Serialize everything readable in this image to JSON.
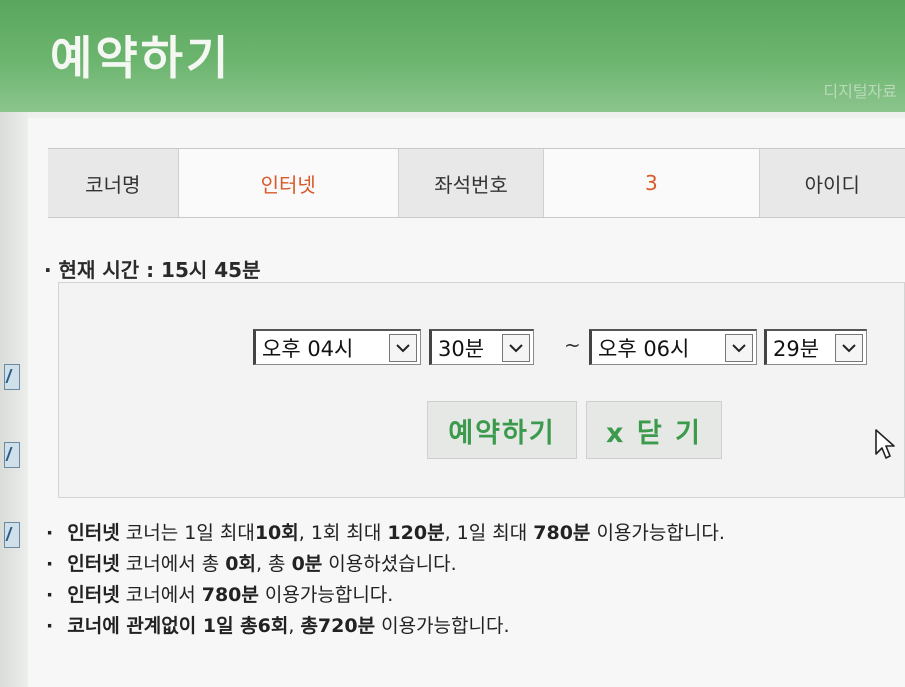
{
  "header": {
    "title": "예약하기",
    "corner_text": "디지털자료"
  },
  "info": {
    "corner_label": "코너명",
    "corner_value": "인터넷",
    "seat_label": "좌석번호",
    "seat_value": "3",
    "id_label": "아이디"
  },
  "current_time": "· 현재 시간 : 15시 45분",
  "selects": {
    "start_hour": "오후 04시",
    "start_min": "30분",
    "separator": "~",
    "end_hour": "오후 06시",
    "end_min": "29분"
  },
  "buttons": {
    "reserve": "예약하기",
    "close": "x 닫 기"
  },
  "notes": [
    {
      "a": "인터넷",
      "b": " 코너는 1일 최대",
      "c": "10회",
      "d": ", 1회 최대 ",
      "e": "120분",
      "f": ", 1일 최대 ",
      "g": "780분",
      "h": " 이용가능합니다."
    },
    {
      "a": "인터넷",
      "b": " 코너에서 총 ",
      "c": "0회",
      "d": ", 총 ",
      "e": "0분",
      "f": " 이용하셨습니다.",
      "g": "",
      "h": ""
    },
    {
      "a": "인터넷",
      "b": " 코너에서 ",
      "c": "780분",
      "d": " 이용가능합니다.",
      "e": "",
      "f": "",
      "g": "",
      "h": ""
    },
    {
      "a": "코너에 관계없이 1일 총6회",
      "b": ", ",
      "c": "총720분",
      "d": " 이용가능합니다.",
      "e": "",
      "f": "",
      "g": "",
      "h": ""
    }
  ],
  "colors": {
    "header_green": "#6cb56f",
    "button_text_green": "#3c9a4c",
    "value_orange": "#d85a2a"
  },
  "icons": {
    "dropdown": "chevron-down-icon",
    "cursor": "mouse-pointer-icon"
  }
}
